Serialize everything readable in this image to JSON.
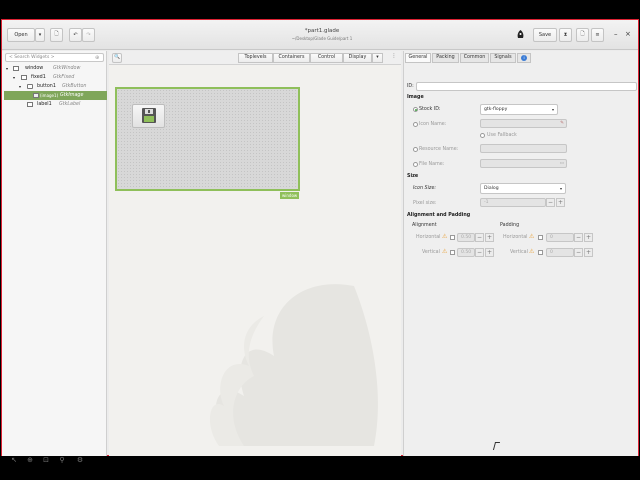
{
  "header": {
    "title": "*part1.glade",
    "subtitle": "~/Desktop/Glade Guide/part 1",
    "open_label": "Open",
    "save_label": "Save"
  },
  "left": {
    "search_placeholder": "< Search Widgets >",
    "tree": [
      {
        "name": "window",
        "type": "GtkWindow"
      },
      {
        "name": "fixed1",
        "type": "GtkFixed"
      },
      {
        "name": "button1",
        "type": "GtkButton"
      },
      {
        "name": "(image1)",
        "type": "GtkImage"
      },
      {
        "name": "label1",
        "type": "GtkLabel"
      }
    ]
  },
  "center": {
    "tabs": [
      "Toplevels",
      "Containers",
      "Control",
      "Display"
    ],
    "window_tag": "window"
  },
  "right": {
    "tabs": [
      "General",
      "Packing",
      "Common",
      "Signals"
    ],
    "id_label": "ID:",
    "image_section": "Image",
    "stock_id_label": "Stock ID:",
    "stock_id_value": "gtk-floppy",
    "icon_name_label": "Icon Name:",
    "use_fallback_label": "Use Fallback",
    "resource_name_label": "Resource Name:",
    "file_name_label": "File Name:",
    "size_section": "Size",
    "icon_size_label": "Icon Size:",
    "icon_size_value": "Dialog",
    "pixel_size_label": "Pixel size:",
    "pixel_size_value": "-1",
    "align_section": "Alignment and Padding",
    "alignment_label": "Alignment",
    "padding_label": "Padding",
    "horizontal_label": "Horizontal",
    "vertical_label": "Vertical",
    "align_h_value": "0.50",
    "align_v_value": "0.50",
    "pad_h_value": "0",
    "pad_v_value": "0"
  }
}
